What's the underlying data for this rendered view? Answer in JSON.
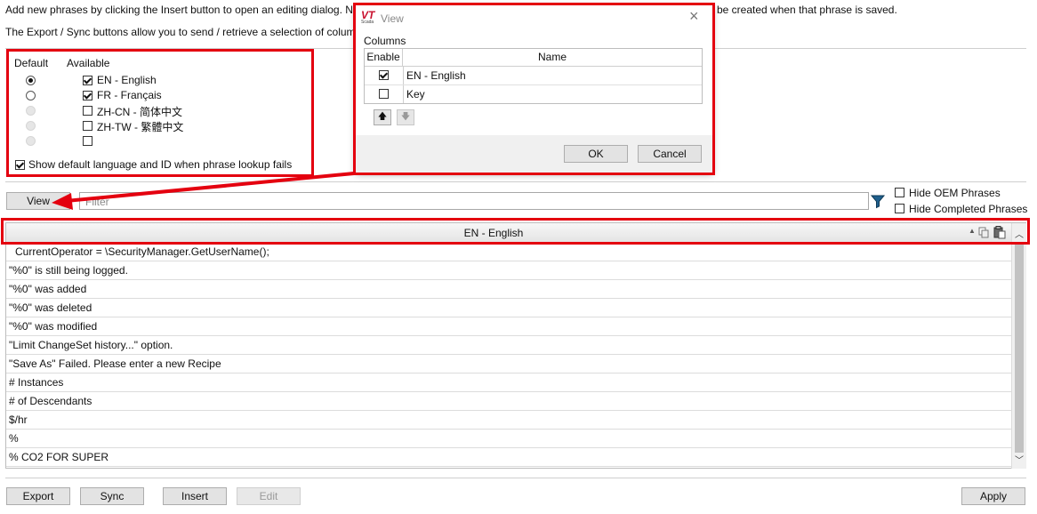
{
  "intro": {
    "line1": "Add new phrases by clicking the Insert button to open an editing dialog. N",
    "line1_right": "be created when that phrase is saved.",
    "line2": "The Export / Sync buttons allow you to send / retrieve a selection of colum"
  },
  "languages": {
    "default_header": "Default",
    "available_header": "Available",
    "items": [
      {
        "label": "EN - English",
        "default": true,
        "checked": true
      },
      {
        "label": "FR - Français",
        "default": false,
        "checked": true
      },
      {
        "label": "ZH-CN - 简体中文",
        "default": false,
        "checked": false
      },
      {
        "label": "ZH-TW - 繁體中文",
        "default": false,
        "checked": false
      },
      {
        "label": "",
        "default": false,
        "checked": false
      }
    ],
    "show_default_label": "Show default language and ID when phrase lookup fails"
  },
  "toolbar": {
    "view_label": "View",
    "filter_placeholder": "Filter",
    "hide_oem_label": "Hide OEM Phrases",
    "hide_completed_label": "Hide Completed Phrases"
  },
  "grid": {
    "column_header": "EN - English",
    "rows": [
      "CurrentOperator = \\SecurityManager.GetUserName();",
      "\"%0\" is still being logged.",
      "\"%0\" was added",
      "\"%0\" was deleted",
      "\"%0\" was modified",
      "\"Limit ChangeSet history...\" option.",
      "\"Save As\" Failed. Please enter a new Recipe",
      "# Instances",
      "# of Descendants",
      "$/hr",
      "%",
      "% CO2 FOR SUPER"
    ]
  },
  "buttons": {
    "export": "Export",
    "sync": "Sync",
    "insert": "Insert",
    "edit": "Edit",
    "apply": "Apply"
  },
  "dialog": {
    "logo_text": "VT",
    "logo_sub": "Scada",
    "title": "View",
    "columns_label": "Columns",
    "enable_header": "Enable",
    "name_header": "Name",
    "rows": [
      {
        "name": "EN - English",
        "enabled": true
      },
      {
        "name": "Key",
        "enabled": false
      }
    ],
    "ok_label": "OK",
    "cancel_label": "Cancel"
  },
  "colors": {
    "highlight_red": "#e4000f",
    "filter_icon": "#1f5f8c"
  }
}
